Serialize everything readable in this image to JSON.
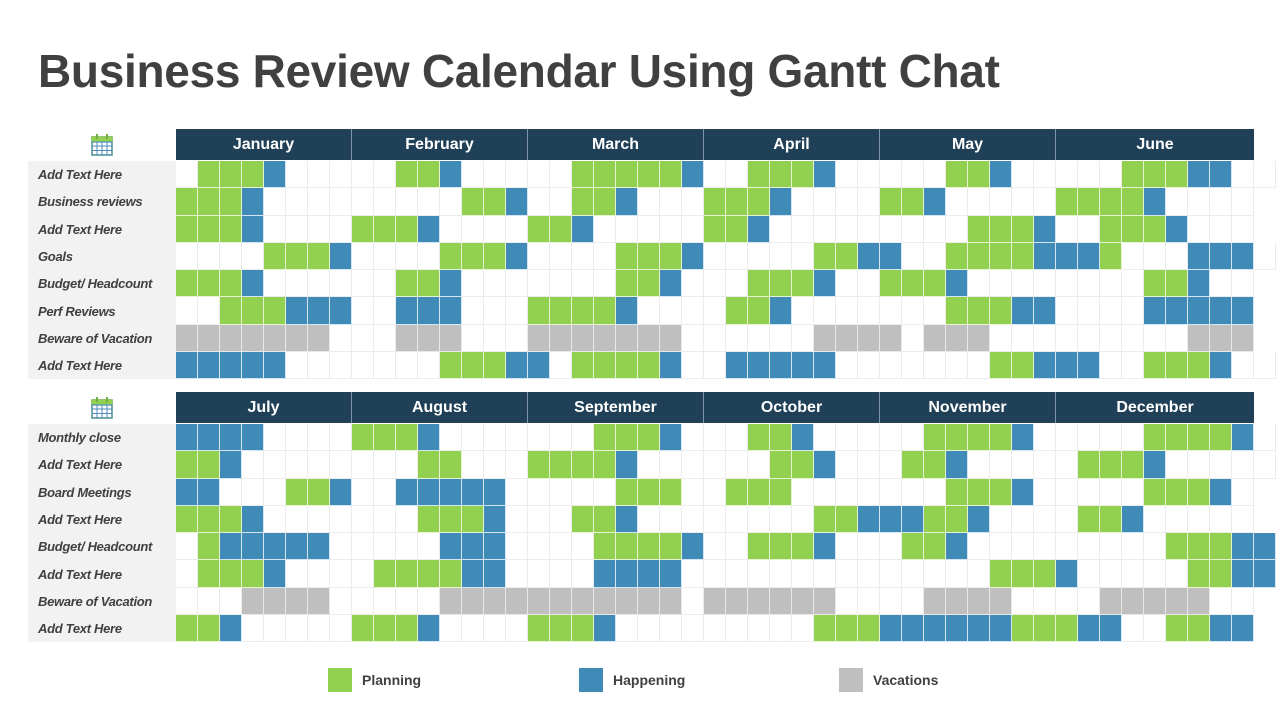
{
  "title": "Business Review Calendar Using Gantt Chat",
  "colors": {
    "planning": "#92d050",
    "happening": "#3f8ab7",
    "vacation": "#bfbfbf",
    "header": "#1f4056"
  },
  "legend": [
    {
      "key": "g",
      "label": "Planning"
    },
    {
      "key": "b",
      "label": "Happening"
    },
    {
      "key": "v",
      "label": "Vacations"
    }
  ],
  "chart_data": {
    "type": "table",
    "title": "Business Review Calendar Using Gantt Chat",
    "cell_codes": {
      "g": "Planning",
      "b": "Happening",
      "v": "Vacations",
      ".": "Empty"
    },
    "sections": [
      {
        "months": [
          {
            "name": "January",
            "columns": 8
          },
          {
            "name": "February",
            "columns": 8
          },
          {
            "name": "March",
            "columns": 8
          },
          {
            "name": "April",
            "columns": 8
          },
          {
            "name": "May",
            "columns": 8
          },
          {
            "name": "June",
            "columns": 9
          }
        ],
        "rows": [
          {
            "label": "Add Text Here",
            "cells": ".gggb.....ggb.....gggggb..gggb.....ggb.....gggbb.."
          },
          {
            "label": "Business reviews",
            "cells": "gggb.........ggb..ggb...gggb....ggb.....ggggb...."
          },
          {
            "label": "Add Text Here",
            "cells": "gggb....gggb....ggb.....ggb.........gggb..gggb..."
          },
          {
            "label": "Goals",
            "cells": "....gggb....gggb....gggb.....ggbb..ggggbbbg...bbb."
          },
          {
            "label": "Budget/ Headcount",
            "cells": "gggb......ggb.......ggb...gggb..gggb........ggb.."
          },
          {
            "label": "Perf Reviews",
            "cells": "..gggbbb..bbb...ggggb....ggb.......gggbb....bbbbb"
          },
          {
            "label": "Beware of Vacation",
            "cells": "vvvvvvv...vvv...vvvvvvv......vvvv.vvv.........vvv"
          },
          {
            "label": "Add Text Here",
            "cells": "bbbbb.......gggbb.ggggb..bbbbb.......ggbbb..gggb.."
          }
        ]
      },
      {
        "months": [
          {
            "name": "July",
            "columns": 8
          },
          {
            "name": "August",
            "columns": 8
          },
          {
            "name": "September",
            "columns": 8
          },
          {
            "name": "October",
            "columns": 8
          },
          {
            "name": "November",
            "columns": 8
          },
          {
            "name": "December",
            "columns": 9
          }
        ],
        "rows": [
          {
            "label": "Monthly close",
            "cells": "bbbb....gggb.......gggb...ggb.....ggggb.....ggggb."
          },
          {
            "label": "Add Text Here",
            "cells": "ggb........gg...ggggb......ggb...ggb.....gggb....."
          },
          {
            "label": "Board Meetings",
            "cells": "bb...ggb..bbbbb.....ggg..ggg.......gggb.....gggb."
          },
          {
            "label": "Add Text Here",
            "cells": "gggb.......gggb...ggb........ggbbbggb....ggb....."
          },
          {
            "label": "Budget/ Headcount",
            "cells": ".gbbbbb.....bbb....ggggb..gggb...ggb.........gggbb"
          },
          {
            "label": "Add Text Here",
            "cells": ".gggb....ggggbb....bbbb..............gggb.....ggbb"
          },
          {
            "label": "Beware of Vacation",
            "cells": "...vvvv.....vvvvvvvvvvv.vvvvvv....vvvv....vvvvv.."
          },
          {
            "label": "Add Text Here",
            "cells": "ggb.....gggb....gggb.........gggbbbbbbgggbb..ggbb"
          }
        ]
      }
    ]
  }
}
